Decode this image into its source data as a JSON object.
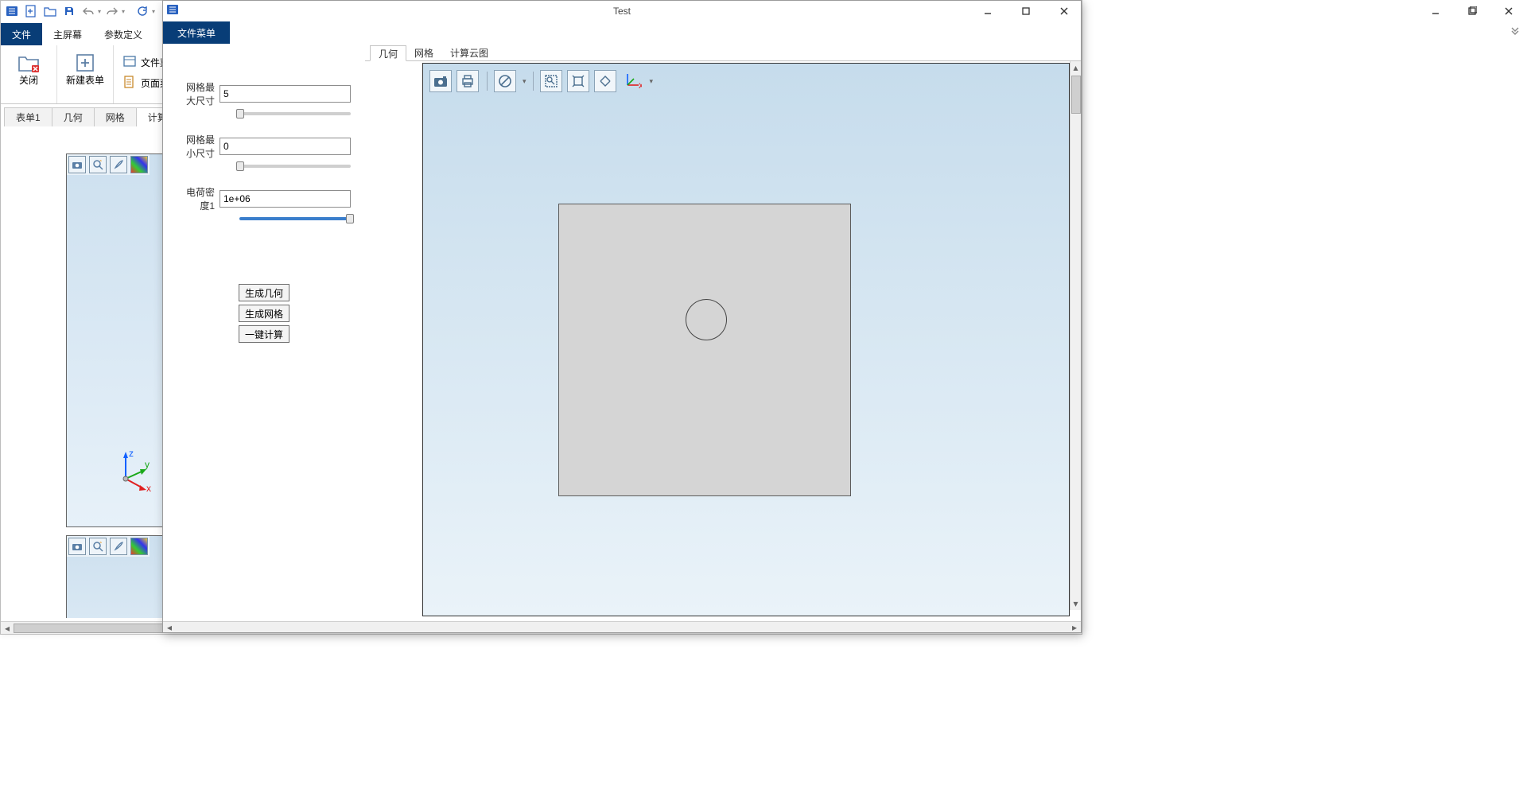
{
  "outer": {
    "min": "—",
    "max": "▢",
    "close": "✕"
  },
  "back_window": {
    "qat": [
      "app",
      "new",
      "open",
      "save",
      "undo",
      "redo",
      "refresh"
    ],
    "ribbon_tabs": {
      "file": "文件",
      "main_screen": "主屏幕",
      "param_def": "参数定义"
    },
    "ribbon": {
      "close_btn": "关闭",
      "new_form_btn": "新建表单",
      "file_menu_btn": "文件菜单",
      "page_menu_btn": "页面菜单"
    },
    "doc_tabs": {
      "form1": "表单1",
      "geometry": "几何",
      "mesh": "网格",
      "calc_cloud": "计算云图"
    }
  },
  "float": {
    "title": "Test",
    "tab_file_menu": "文件菜单",
    "params": {
      "max_mesh_label": "网格最大尺寸",
      "max_mesh_value": "5",
      "min_mesh_label": "网格最小尺寸",
      "min_mesh_value": "0",
      "charge_density_label": "电荷密度1",
      "charge_density_value": "1e+06"
    },
    "buttons": {
      "gen_geometry": "生成几何",
      "gen_mesh": "生成网格",
      "one_click_calc": "一键计算"
    },
    "view_tabs": {
      "geometry": "几何",
      "mesh": "网格",
      "calc_cloud": "计算云图"
    },
    "axes": {
      "x": "x",
      "y": "y",
      "z": "z"
    }
  }
}
